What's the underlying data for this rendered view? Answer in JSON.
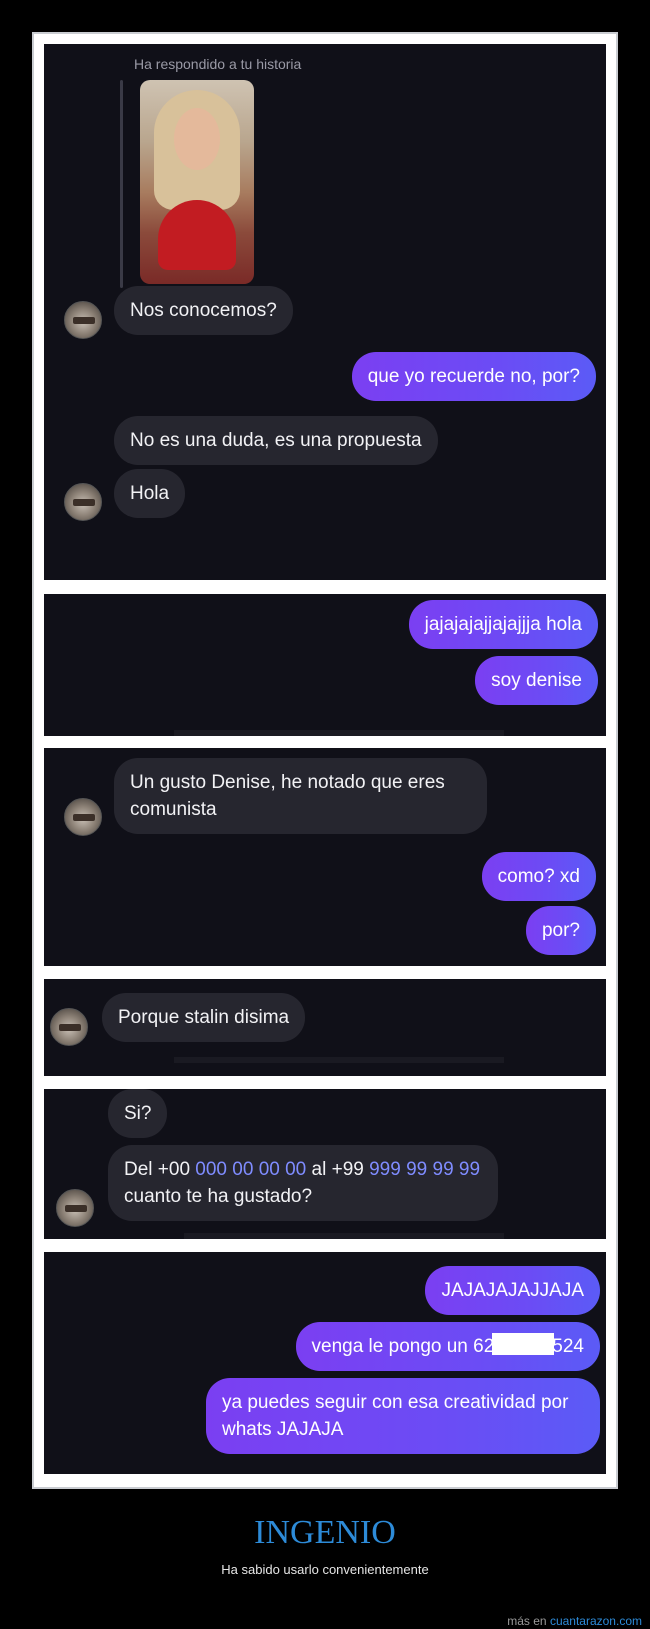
{
  "panel1": {
    "story_label": "Ha respondido a tu historia",
    "messages": [
      "Nos conocemos?",
      "que yo recuerde no, por?",
      "No es una duda, es una propuesta",
      "Hola"
    ]
  },
  "panel2": {
    "messages": [
      "jajajajajjajajjja hola",
      "soy denise"
    ]
  },
  "panel3": {
    "messages": [
      "Un gusto Denise, he notado que eres comunista",
      "como? xd",
      "por?"
    ]
  },
  "panel4": {
    "messages": [
      "Porque stalin disima"
    ]
  },
  "panel5": {
    "messages": [
      "Si?"
    ],
    "phone_msg": {
      "prefix": "Del +00 ",
      "number1": "000 00 00 00",
      "middle": " al +99 ",
      "number2a": "999 99",
      "number2b": "99 99",
      "suffix": " cuanto te ha gustado?"
    }
  },
  "panel6": {
    "messages": [
      "JAJAJAJAJJAJA",
      "ya puedes seguir con esa creatividad por whats JAJAJA"
    ],
    "redacted_msg": {
      "before": "venga le pongo un 62",
      "after": "524"
    }
  },
  "footer": {
    "title": "INGENIO",
    "subtitle": "Ha sabido usarlo convenientemente",
    "credit_prefix": "más en ",
    "credit_site": "cuantarazon.com"
  },
  "colors": {
    "background": "#000000",
    "panel": "#101018",
    "incoming_bubble": "#26262f",
    "outgoing_bubble_start": "#7b3ff2",
    "outgoing_bubble_end": "#5b5bf6",
    "footer_title": "#2d8bd8"
  }
}
